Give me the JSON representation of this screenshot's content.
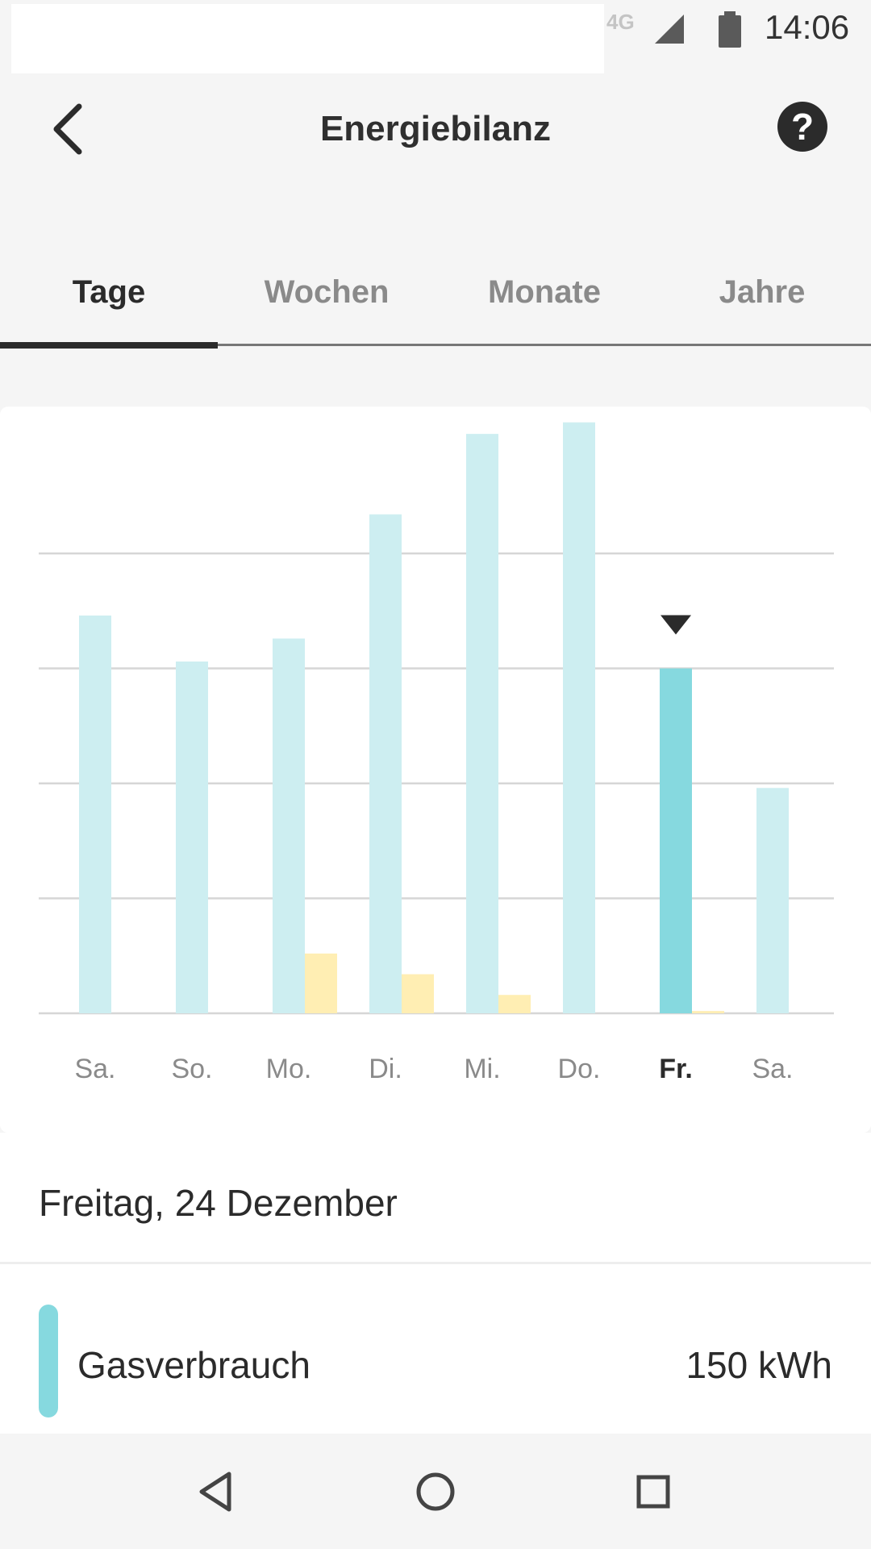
{
  "status_bar": {
    "network_type": "4G",
    "time": "14:06",
    "icons": [
      "signal-icon",
      "battery-icon"
    ]
  },
  "app_bar": {
    "title": "Energiebilanz",
    "back_icon": "chevron-left-icon",
    "help_label": "?"
  },
  "tabs": [
    {
      "label": "Tage",
      "active": true
    },
    {
      "label": "Wochen",
      "active": false
    },
    {
      "label": "Monate",
      "active": false
    },
    {
      "label": "Jahre",
      "active": false
    }
  ],
  "colors": {
    "gas": "#cdeef1",
    "gas_selected": "#86d9df",
    "secondary": "#ffeeb3",
    "gridline": "#d6d6d6",
    "text_dark": "#2b2b2b",
    "text_muted": "#8a8a8a"
  },
  "chart_data": {
    "type": "bar",
    "categories": [
      "Sa.",
      "So.",
      "Mo.",
      "Di.",
      "Mi.",
      "Do.",
      "Fr.",
      "Sa."
    ],
    "series": [
      {
        "values": [
          173,
          153,
          163,
          217,
          252,
          257,
          150,
          98
        ]
      },
      {
        "values": [
          0,
          0,
          26,
          17,
          8,
          0,
          1,
          0
        ]
      }
    ],
    "selected_index": 6,
    "ylim": [
      0,
      250
    ],
    "y_gridlines": [
      0,
      50,
      100,
      150,
      200
    ],
    "y_tick_labels_shown": false,
    "grid": true,
    "legend": false
  },
  "selection": {
    "date_label": "Freitag, 24 Dezember",
    "legend_label": "Gasverbrauch",
    "legend_value": "150 kWh"
  },
  "nav_bar": {
    "icons": [
      "back-triangle-icon",
      "home-circle-icon",
      "recents-square-icon"
    ]
  }
}
